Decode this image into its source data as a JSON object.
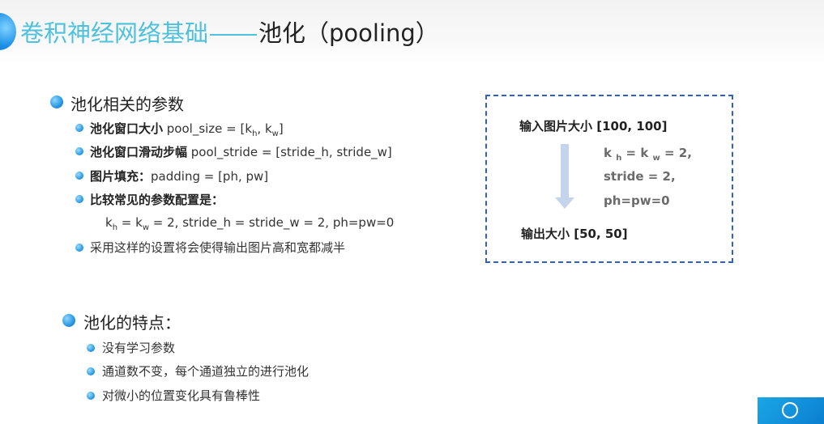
{
  "title": {
    "part1": "卷积神经网络基础",
    "part2": "池化（pooling）"
  },
  "section1": {
    "heading": "池化相关的参数",
    "items": [
      {
        "bold": "池化窗口大小",
        "pre": " pool_size = [k",
        "sub1": "h",
        "mid": ", k",
        "sub2": "w",
        "post": "]"
      },
      {
        "bold": "池化窗口滑动步幅",
        "text": " pool_stride = [stride_h, stride_w]"
      },
      {
        "bold": "图片填充：",
        "text": "padding = [ph, pw]"
      },
      {
        "bold": "比较常见的参数配置是："
      },
      {
        "pre": "k",
        "sub1": "h",
        "mid": " = k",
        "sub2": "w",
        "post": " = 2, stride_h = stride_w = 2, ph=pw=0"
      },
      {
        "text": "采用这样的设置将会使得输出图片高和宽都减半"
      }
    ]
  },
  "diagram": {
    "input": "输入图片大小 [100, 100]",
    "param1": {
      "a": "k ",
      "sa": "h",
      "b": " = k ",
      "sb": "w",
      "c": " = 2,"
    },
    "param2": "stride = 2,",
    "param3": "ph=pw=0",
    "output": "输出大小 [50, 50]"
  },
  "section2": {
    "heading": "池化的特点：",
    "items": [
      "没有学习参数",
      "通道数不变，每个通道独立的进行池化",
      "对微小的位置变化具有鲁棒性"
    ]
  }
}
